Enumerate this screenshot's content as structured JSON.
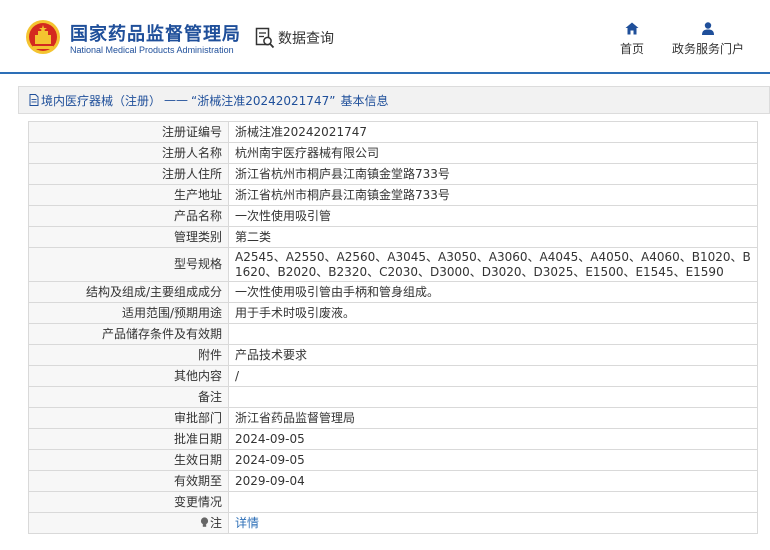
{
  "header": {
    "brand_cn": "国家药品监督管理局",
    "brand_en": "National Medical Products Administration",
    "query_label": "数据查询",
    "nav": {
      "home_label": "首页",
      "gov_label": "政务服务门户"
    }
  },
  "colors": {
    "brand_blue": "#1f4f9a",
    "link_blue": "#2d6fb7",
    "emblem_red": "#d42a1f",
    "emblem_gold": "#f4c430"
  },
  "icons": {
    "emblem": "national-emblem-icon",
    "query": "search-document-icon",
    "home": "home-icon",
    "user": "user-icon",
    "doc": "document-icon",
    "bulb": "lightbulb-icon"
  },
  "panel": {
    "breadcrumb_category": "境内医疗器械（注册）",
    "breadcrumb_sep": "——",
    "breadcrumb_record": "“浙械注准20242021747”",
    "breadcrumb_suffix": "基本信息"
  },
  "rows": [
    {
      "label": "注册证编号",
      "value": "浙械注准20242021747"
    },
    {
      "label": "注册人名称",
      "value": "杭州南宇医疗器械有限公司"
    },
    {
      "label": "注册人住所",
      "value": "浙江省杭州市桐庐县江南镇金堂路733号"
    },
    {
      "label": "生产地址",
      "value": "浙江省杭州市桐庐县江南镇金堂路733号"
    },
    {
      "label": "产品名称",
      "value": "一次性使用吸引管"
    },
    {
      "label": "管理类别",
      "value": "第二类"
    },
    {
      "label": "型号规格",
      "value": "A2545、A2550、A2560、A3045、A3050、A3060、A4045、A4050、A4060、B1020、B1620、B2020、B2320、C2030、D3000、D3020、D3025、E1500、E1545、E1590"
    },
    {
      "label": "结构及组成/主要组成成分",
      "value": "一次性使用吸引管由手柄和管身组成。"
    },
    {
      "label": "适用范围/预期用途",
      "value": "用于手术时吸引废液。"
    },
    {
      "label": "产品储存条件及有效期",
      "value": ""
    },
    {
      "label": "附件",
      "value": "产品技术要求"
    },
    {
      "label": "其他内容",
      "value": "/"
    },
    {
      "label": "备注",
      "value": ""
    },
    {
      "label": "审批部门",
      "value": "浙江省药品监督管理局"
    },
    {
      "label": "批准日期",
      "value": "2024-09-05"
    },
    {
      "label": "生效日期",
      "value": "2024-09-05"
    },
    {
      "label": "有效期至",
      "value": "2029-09-04"
    },
    {
      "label": "变更情况",
      "value": ""
    },
    {
      "label": "注",
      "value": "详情"
    }
  ]
}
